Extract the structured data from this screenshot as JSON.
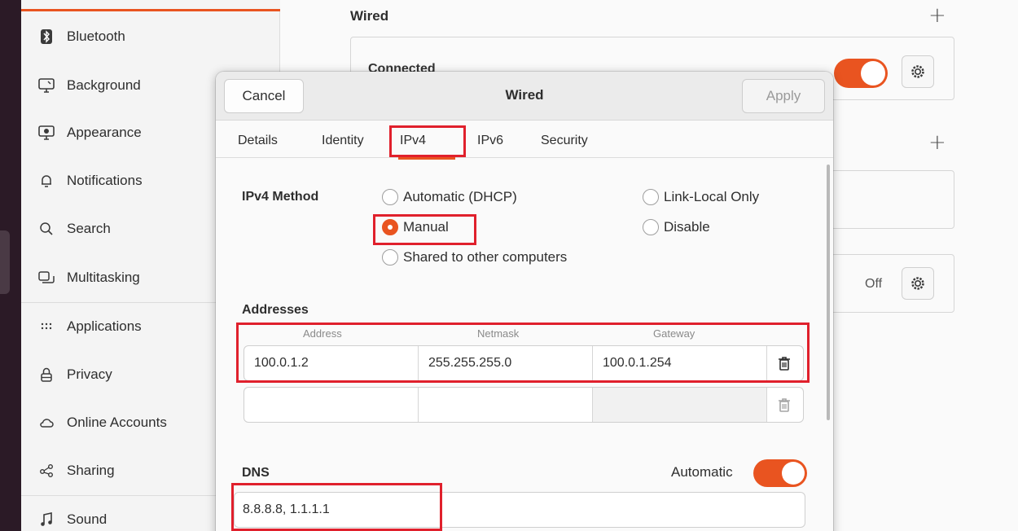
{
  "sidebar": {
    "items": [
      {
        "label": "Bluetooth",
        "icon": "bluetooth-icon"
      },
      {
        "label": "Background",
        "icon": "monitor-icon"
      },
      {
        "label": "Appearance",
        "icon": "appearance-icon"
      },
      {
        "label": "Notifications",
        "icon": "bell-icon"
      },
      {
        "label": "Search",
        "icon": "search-icon"
      },
      {
        "label": "Multitasking",
        "icon": "multitasking-icon"
      },
      {
        "label": "Applications",
        "icon": "grid-icon"
      },
      {
        "label": "Privacy",
        "icon": "lock-icon"
      },
      {
        "label": "Online Accounts",
        "icon": "cloud-icon"
      },
      {
        "label": "Sharing",
        "icon": "share-icon"
      },
      {
        "label": "Sound",
        "icon": "music-note-icon"
      }
    ]
  },
  "main": {
    "section_title": "Wired",
    "connection_status": "Connected",
    "vpn_status": "Off"
  },
  "dialog": {
    "title": "Wired",
    "cancel_label": "Cancel",
    "apply_label": "Apply",
    "tabs": [
      "Details",
      "Identity",
      "IPv4",
      "IPv6",
      "Security"
    ],
    "active_tab": "IPv4",
    "method_label": "IPv4 Method",
    "methods": {
      "automatic": "Automatic (DHCP)",
      "link_local": "Link-Local Only",
      "manual": "Manual",
      "disable": "Disable",
      "shared": "Shared to other computers"
    },
    "selected_method": "Manual",
    "addresses_label": "Addresses",
    "columns": {
      "address": "Address",
      "netmask": "Netmask",
      "gateway": "Gateway"
    },
    "rows": [
      {
        "address": "100.0.1.2",
        "netmask": "255.255.255.0",
        "gateway": "100.0.1.254"
      },
      {
        "address": "",
        "netmask": "",
        "gateway": ""
      }
    ],
    "dns_label": "DNS",
    "dns_automatic_label": "Automatic",
    "dns_automatic_on": true,
    "dns_value": "8.8.8.8, 1.1.1.1"
  },
  "colors": {
    "accent": "#e95420",
    "highlight": "#e0202c"
  }
}
